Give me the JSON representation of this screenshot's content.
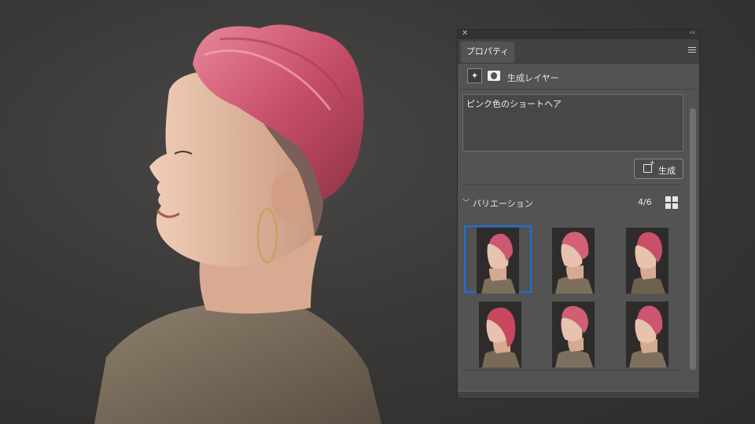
{
  "panel": {
    "close_icon": "close-icon",
    "collapse_icon": "double-chevron-icon",
    "tab_label": "プロパティ",
    "menu_icon": "hamburger-menu-icon"
  },
  "layer": {
    "type_icon": "generative-sparkle-icon",
    "mask_icon": "layer-mask-icon",
    "label": "生成レイヤー"
  },
  "prompt": {
    "value": "ピンク色のショートヘア"
  },
  "generate_button": {
    "label": "生成",
    "icon": "generate-icon"
  },
  "variations": {
    "title": "バリエーション",
    "count": "4/6",
    "selected_index": 0,
    "collapse_icon": "chevron-down-icon",
    "view_icon": "grid-view-icon"
  },
  "colors": {
    "panel_bg": "#535353",
    "selection": "#1473e6",
    "hair_pink": "#d05a72"
  }
}
